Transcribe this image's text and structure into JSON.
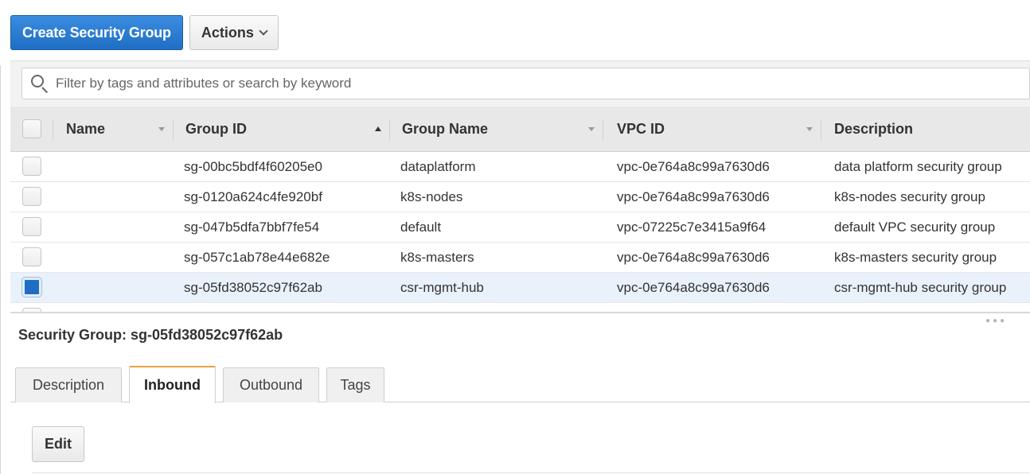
{
  "toolbar": {
    "create_label": "Create Security Group",
    "actions_label": "Actions"
  },
  "filter": {
    "placeholder": "Filter by tags and attributes or search by keyword"
  },
  "table": {
    "columns": [
      "Name",
      "Group ID",
      "Group Name",
      "VPC ID",
      "Description"
    ],
    "sorted_column": "Group ID",
    "sort_direction": "ascending",
    "rows": [
      {
        "name": "",
        "group_id": "sg-00bc5bdf4f60205e0",
        "group_name": "dataplatform",
        "vpc_id": "vpc-0e764a8c99a7630d6",
        "description": "data platform security group",
        "selected": false
      },
      {
        "name": "",
        "group_id": "sg-0120a624c4fe920bf",
        "group_name": "k8s-nodes",
        "vpc_id": "vpc-0e764a8c99a7630d6",
        "description": "k8s-nodes security group",
        "selected": false
      },
      {
        "name": "",
        "group_id": "sg-047b5dfa7bbf7fe54",
        "group_name": "default",
        "vpc_id": "vpc-07225c7e3415a9f64",
        "description": "default VPC security group",
        "selected": false
      },
      {
        "name": "",
        "group_id": "sg-057c1ab78e44e682e",
        "group_name": "k8s-masters",
        "vpc_id": "vpc-0e764a8c99a7630d6",
        "description": "k8s-masters security group",
        "selected": false
      },
      {
        "name": "",
        "group_id": "sg-05fd38052c97f62ab",
        "group_name": "csr-mgmt-hub",
        "vpc_id": "vpc-0e764a8c99a7630d6",
        "description": "csr-mgmt-hub security group",
        "selected": true
      }
    ]
  },
  "details": {
    "title": "Security Group: sg-05fd38052c97f62ab",
    "tabs": [
      {
        "label": "Description",
        "active": false
      },
      {
        "label": "Inbound",
        "active": true
      },
      {
        "label": "Outbound",
        "active": false
      },
      {
        "label": "Tags",
        "active": false
      }
    ],
    "edit_label": "Edit"
  },
  "colors": {
    "primary": "#1f6ec4",
    "active_tab_accent": "#e8a33d",
    "selected_row": "#e9f1fb"
  }
}
